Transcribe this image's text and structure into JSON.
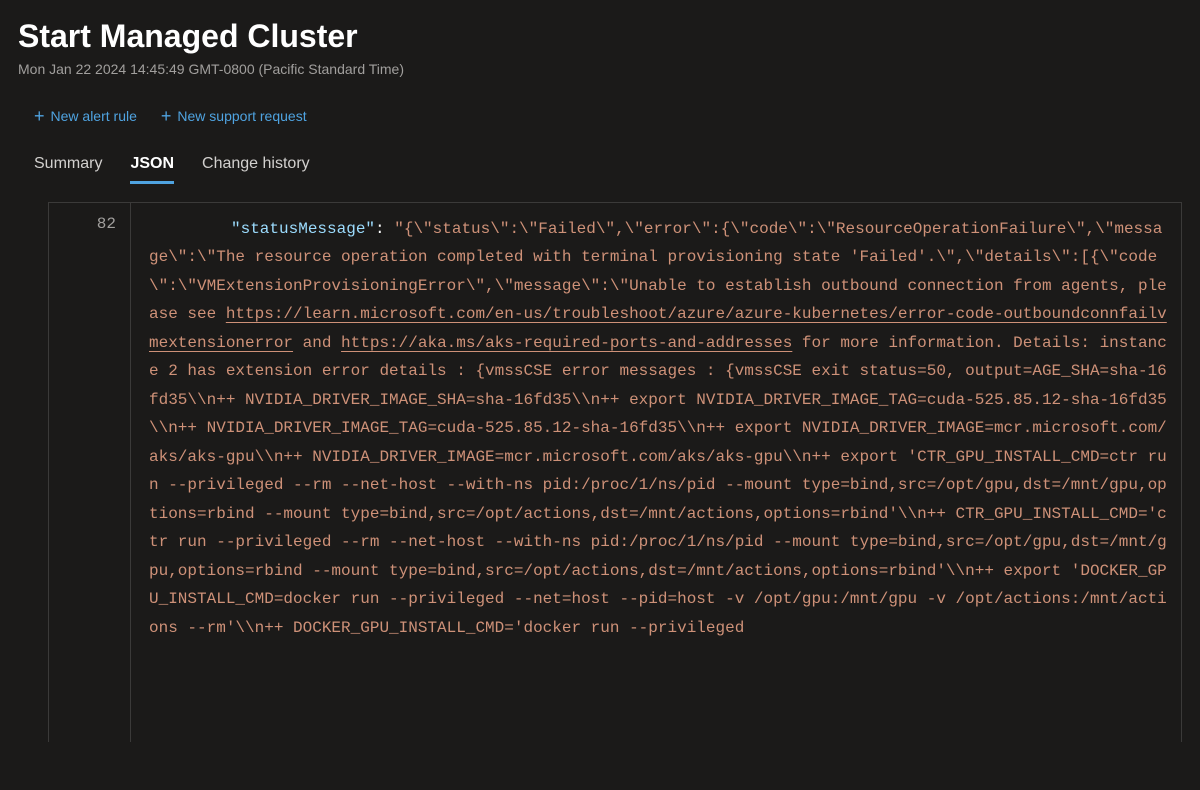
{
  "header": {
    "title": "Start Managed Cluster",
    "timestamp": "Mon Jan 22 2024 14:45:49 GMT-0800 (Pacific Standard Time)"
  },
  "toolbar": {
    "new_alert_rule": "New alert rule",
    "new_support_request": "New support request"
  },
  "tabs": {
    "summary": "Summary",
    "json": "JSON",
    "change_history": "Change history"
  },
  "json_view": {
    "line_number": "82",
    "key": "\"statusMessage\"",
    "value_pre": "\"{\\\"status\\\":\\\"Failed\\\",\\\"error\\\":{\\\"code\\\":\\\"ResourceOperationFailure\\\",\\\"message\\\":\\\"The resource operation completed with terminal provisioning state 'Failed'.\\\",\\\"details\\\":[{\\\"code\\\":\\\"VMExtensionProvisioningError\\\",\\\"message\\\":\\\"Unable to establish outbound connection from agents, please see ",
    "link1": "https://learn.microsoft.com/en-us/troubleshoot/azure/azure-kubernetes/error-code-outboundconnfailvmextensionerror",
    "mid1": " and ",
    "link2": "https://aka.ms/aks-required-ports-and-addresses",
    "value_post": " for more information. Details: instance 2 has extension error details : {vmssCSE error messages : {vmssCSE exit status=50, output=AGE_SHA=sha-16fd35\\\\n++ NVIDIA_DRIVER_IMAGE_SHA=sha-16fd35\\\\n++ export NVIDIA_DRIVER_IMAGE_TAG=cuda-525.85.12-sha-16fd35\\\\n++ NVIDIA_DRIVER_IMAGE_TAG=cuda-525.85.12-sha-16fd35\\\\n++ export NVIDIA_DRIVER_IMAGE=mcr.microsoft.com/aks/aks-gpu\\\\n++ NVIDIA_DRIVER_IMAGE=mcr.microsoft.com/aks/aks-gpu\\\\n++ export 'CTR_GPU_INSTALL_CMD=ctr run --privileged --rm --net-host --with-ns pid:/proc/1/ns/pid --mount type=bind,src=/opt/gpu,dst=/mnt/gpu,options=rbind --mount type=bind,src=/opt/actions,dst=/mnt/actions,options=rbind'\\\\n++ CTR_GPU_INSTALL_CMD='ctr run --privileged --rm --net-host --with-ns pid:/proc/1/ns/pid --mount type=bind,src=/opt/gpu,dst=/mnt/gpu,options=rbind --mount type=bind,src=/opt/actions,dst=/mnt/actions,options=rbind'\\\\n++ export 'DOCKER_GPU_INSTALL_CMD=docker run --privileged --net=host --pid=host -v /opt/gpu:/mnt/gpu -v /opt/actions:/mnt/actions --rm'\\\\n++ DOCKER_GPU_INSTALL_CMD='docker run --privileged"
  }
}
